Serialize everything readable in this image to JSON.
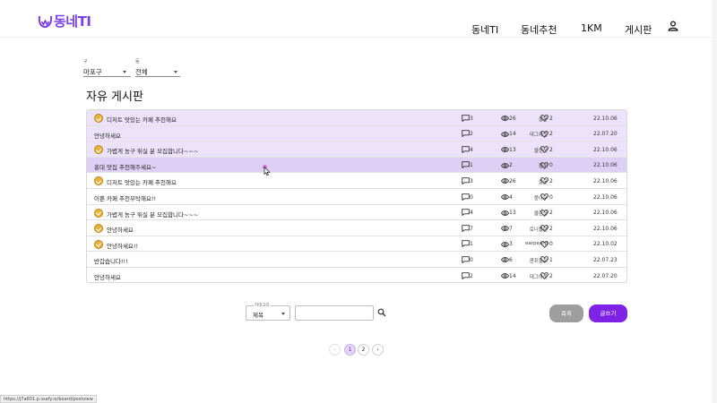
{
  "header": {
    "logo_text": "동네TI",
    "nav": [
      "동네TI",
      "동네추천",
      "1KM",
      "게시판"
    ],
    "user_icon": "person-icon",
    "accent": "#7b3fe4"
  },
  "filters": {
    "district": {
      "label": "구",
      "value": "마포구"
    },
    "dong": {
      "label": "동",
      "value": "전체"
    }
  },
  "board": {
    "title": "자유 게시판",
    "rows": [
      {
        "badge": true,
        "title": "디저트 맛있는 카페 추천해요",
        "author": "살몬",
        "comments": "3",
        "views": "26",
        "likes": "2",
        "date": "22.10.06",
        "highlight": true
      },
      {
        "badge": false,
        "title": "안녕하세요",
        "author": "데그아웃",
        "comments": "2",
        "views": "14",
        "likes": "2",
        "date": "22.07.20",
        "highlight": true
      },
      {
        "badge": true,
        "title": "가볍게 농구 뛰실 분 모집합니다~~~",
        "author": "클린샷",
        "comments": "4",
        "views": "13",
        "likes": "2",
        "date": "22.10.06",
        "highlight": true
      },
      {
        "badge": false,
        "title": "홍대 맛집 추천해주세요~",
        "author": "황씨",
        "comments": "1",
        "views": "2",
        "likes": "0",
        "date": "22.10.06",
        "hover": true
      },
      {
        "badge": true,
        "title": "디저트 맛있는 카페 추천해요",
        "author": "살몬",
        "comments": "3",
        "views": "26",
        "likes": "2",
        "date": "22.10.06"
      },
      {
        "badge": false,
        "title": "이쁜 카페 추천부탁해요!!",
        "author": "뭉나무",
        "comments": "0",
        "views": "4",
        "likes": "0",
        "date": "22.10.06"
      },
      {
        "badge": true,
        "title": "가볍게 농구 뛰실 분 모집합니다~~~",
        "author": "클린샷",
        "comments": "4",
        "views": "13",
        "likes": "2",
        "date": "22.10.06"
      },
      {
        "badge": true,
        "title": "안녕하세요",
        "author": "로니플렌",
        "comments": "7",
        "views": "7",
        "likes": "2",
        "date": "22.10.06"
      },
      {
        "badge": true,
        "title": "안녕하세요!!",
        "author": "earpearp",
        "comments": "1",
        "views": "3",
        "likes": "0",
        "date": "22.10.02"
      },
      {
        "badge": false,
        "title": "반갑습니다!!!",
        "author": "콩쥐들쥐",
        "comments": "0",
        "views": "6",
        "likes": "1",
        "date": "22.07.23"
      },
      {
        "badge": false,
        "title": "안녕하세요",
        "author": "데그아웃",
        "comments": "2",
        "views": "14",
        "likes": "2",
        "date": "22.07.20"
      }
    ]
  },
  "search": {
    "category_label": "카테고리",
    "category_value": "제목",
    "input_value": "",
    "search_icon": "magnifier-icon"
  },
  "buttons": {
    "list": "목록",
    "write": "글쓰기",
    "write_color": "#7e22e5",
    "list_color": "#9e9e9e"
  },
  "pagination": {
    "prev": "‹",
    "pages": [
      "1",
      "2"
    ],
    "next": "›",
    "current": "1"
  },
  "status_url": "https://j7a601.p.ssafy.io/board/postview"
}
